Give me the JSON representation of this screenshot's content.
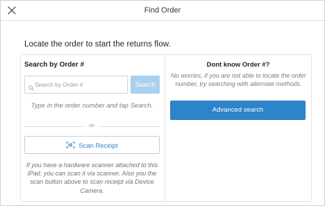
{
  "header": {
    "title": "Find Order",
    "close_icon": "close-icon"
  },
  "intro": "Locate the order to start the returns flow.",
  "order_search": {
    "title": "Search by Order #",
    "placeholder": "Search by Order #",
    "input_value": "",
    "search_label": "Search",
    "hint": "Type in the order number and tap Search.",
    "or_label": "OR",
    "scan_label": "Scan Receipt",
    "scan_icon": "barcode-scan-icon",
    "scan_hint": "If you have a hardware scanner attached to this iPad, you can scan it via scanner. Also you the scan button above to scan receipt via Device Camera."
  },
  "alternate": {
    "title": "Dont know Order #?",
    "description": "No worries, if you are not able to locate the order number, try searching with alternate methods.",
    "button_label": "Advanced search"
  },
  "colors": {
    "accent": "#2e83c9",
    "search_disabled": "#a9d0ef",
    "link": "#2f7fc8"
  }
}
